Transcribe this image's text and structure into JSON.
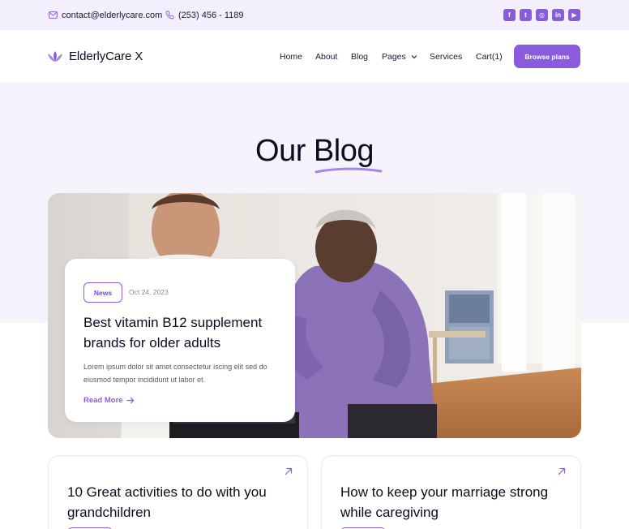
{
  "topbar": {
    "email": "contact@elderlycare.com",
    "phone": "(253) 456 - 1189",
    "socials": [
      {
        "icon": "facebook-icon",
        "glyph": "f"
      },
      {
        "icon": "twitter-icon",
        "glyph": "t"
      },
      {
        "icon": "instagram-icon",
        "glyph": "◎"
      },
      {
        "icon": "linkedin-icon",
        "glyph": "in"
      },
      {
        "icon": "youtube-icon",
        "glyph": "▶"
      }
    ]
  },
  "header": {
    "brand": "ElderlyCare X",
    "nav": [
      "Home",
      "About",
      "Blog",
      "Pages",
      "Services",
      "Cart(1)"
    ],
    "cta": "Browse plans"
  },
  "hero": {
    "title": "Our Blog"
  },
  "featured": {
    "tag": "News",
    "date": "Oct 24, 2023",
    "title": "Best vitamin B12 supplement brands for older adults",
    "excerpt": "Lorem ipsum dolor sit amet consectetur iscing elit sed do eiusmod tempor incididunt ut labor  et.",
    "read_more": "Read More"
  },
  "posts": [
    {
      "title": "10 Great activities to do with you grandchildren"
    },
    {
      "title": "How to keep your marriage strong while caregiving"
    }
  ],
  "colors": {
    "accent": "#8a5cdd",
    "topbar_bg": "#f3effc",
    "hero_bg": "#f6f3fd"
  }
}
